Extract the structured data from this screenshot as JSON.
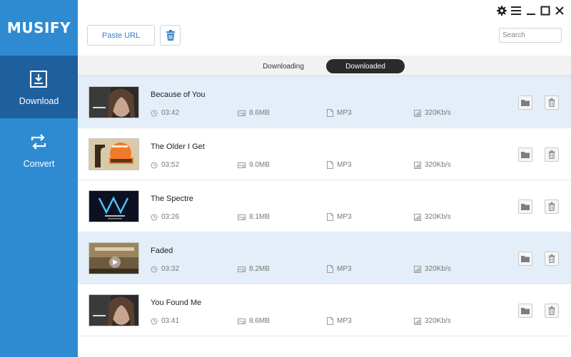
{
  "app": {
    "name": "MUSIFY"
  },
  "sidebar": {
    "items": [
      {
        "label": "Download",
        "icon": "download-icon",
        "active": true
      },
      {
        "label": "Convert",
        "icon": "convert-icon",
        "active": false
      }
    ]
  },
  "toolbar": {
    "paste_url_label": "Paste URL",
    "delete_icon": "trash-icon",
    "search_placeholder": "Search"
  },
  "window_controls": [
    "gear-icon",
    "menu-icon",
    "minimize-icon",
    "maximize-icon",
    "close-icon"
  ],
  "tabs": [
    {
      "label": "Downloading",
      "active": false
    },
    {
      "label": "Downloaded",
      "active": true
    }
  ],
  "colors": {
    "sidebar": "#2e8bd2",
    "sidebar_active": "#1e5f9e",
    "row_highlight": "#e3eef8",
    "active_tab": "#2b2b2b",
    "accent_text": "#3b7fc4"
  },
  "songs": [
    {
      "title": "Because of You",
      "duration": "03:42",
      "size": "8.6MB",
      "format": "MP3",
      "bitrate": "320Kb/s",
      "highlighted": true
    },
    {
      "title": "The Older I Get",
      "duration": "03:52",
      "size": "9.0MB",
      "format": "MP3",
      "bitrate": "320Kb/s",
      "highlighted": false
    },
    {
      "title": "The Spectre",
      "duration": "03:26",
      "size": "8.1MB",
      "format": "MP3",
      "bitrate": "320Kb/s",
      "highlighted": false
    },
    {
      "title": "Faded",
      "duration": "03:32",
      "size": "8.2MB",
      "format": "MP3",
      "bitrate": "320Kb/s",
      "highlighted": true
    },
    {
      "title": "You Found Me",
      "duration": "03:41",
      "size": "8.6MB",
      "format": "MP3",
      "bitrate": "320Kb/s",
      "highlighted": false
    }
  ]
}
